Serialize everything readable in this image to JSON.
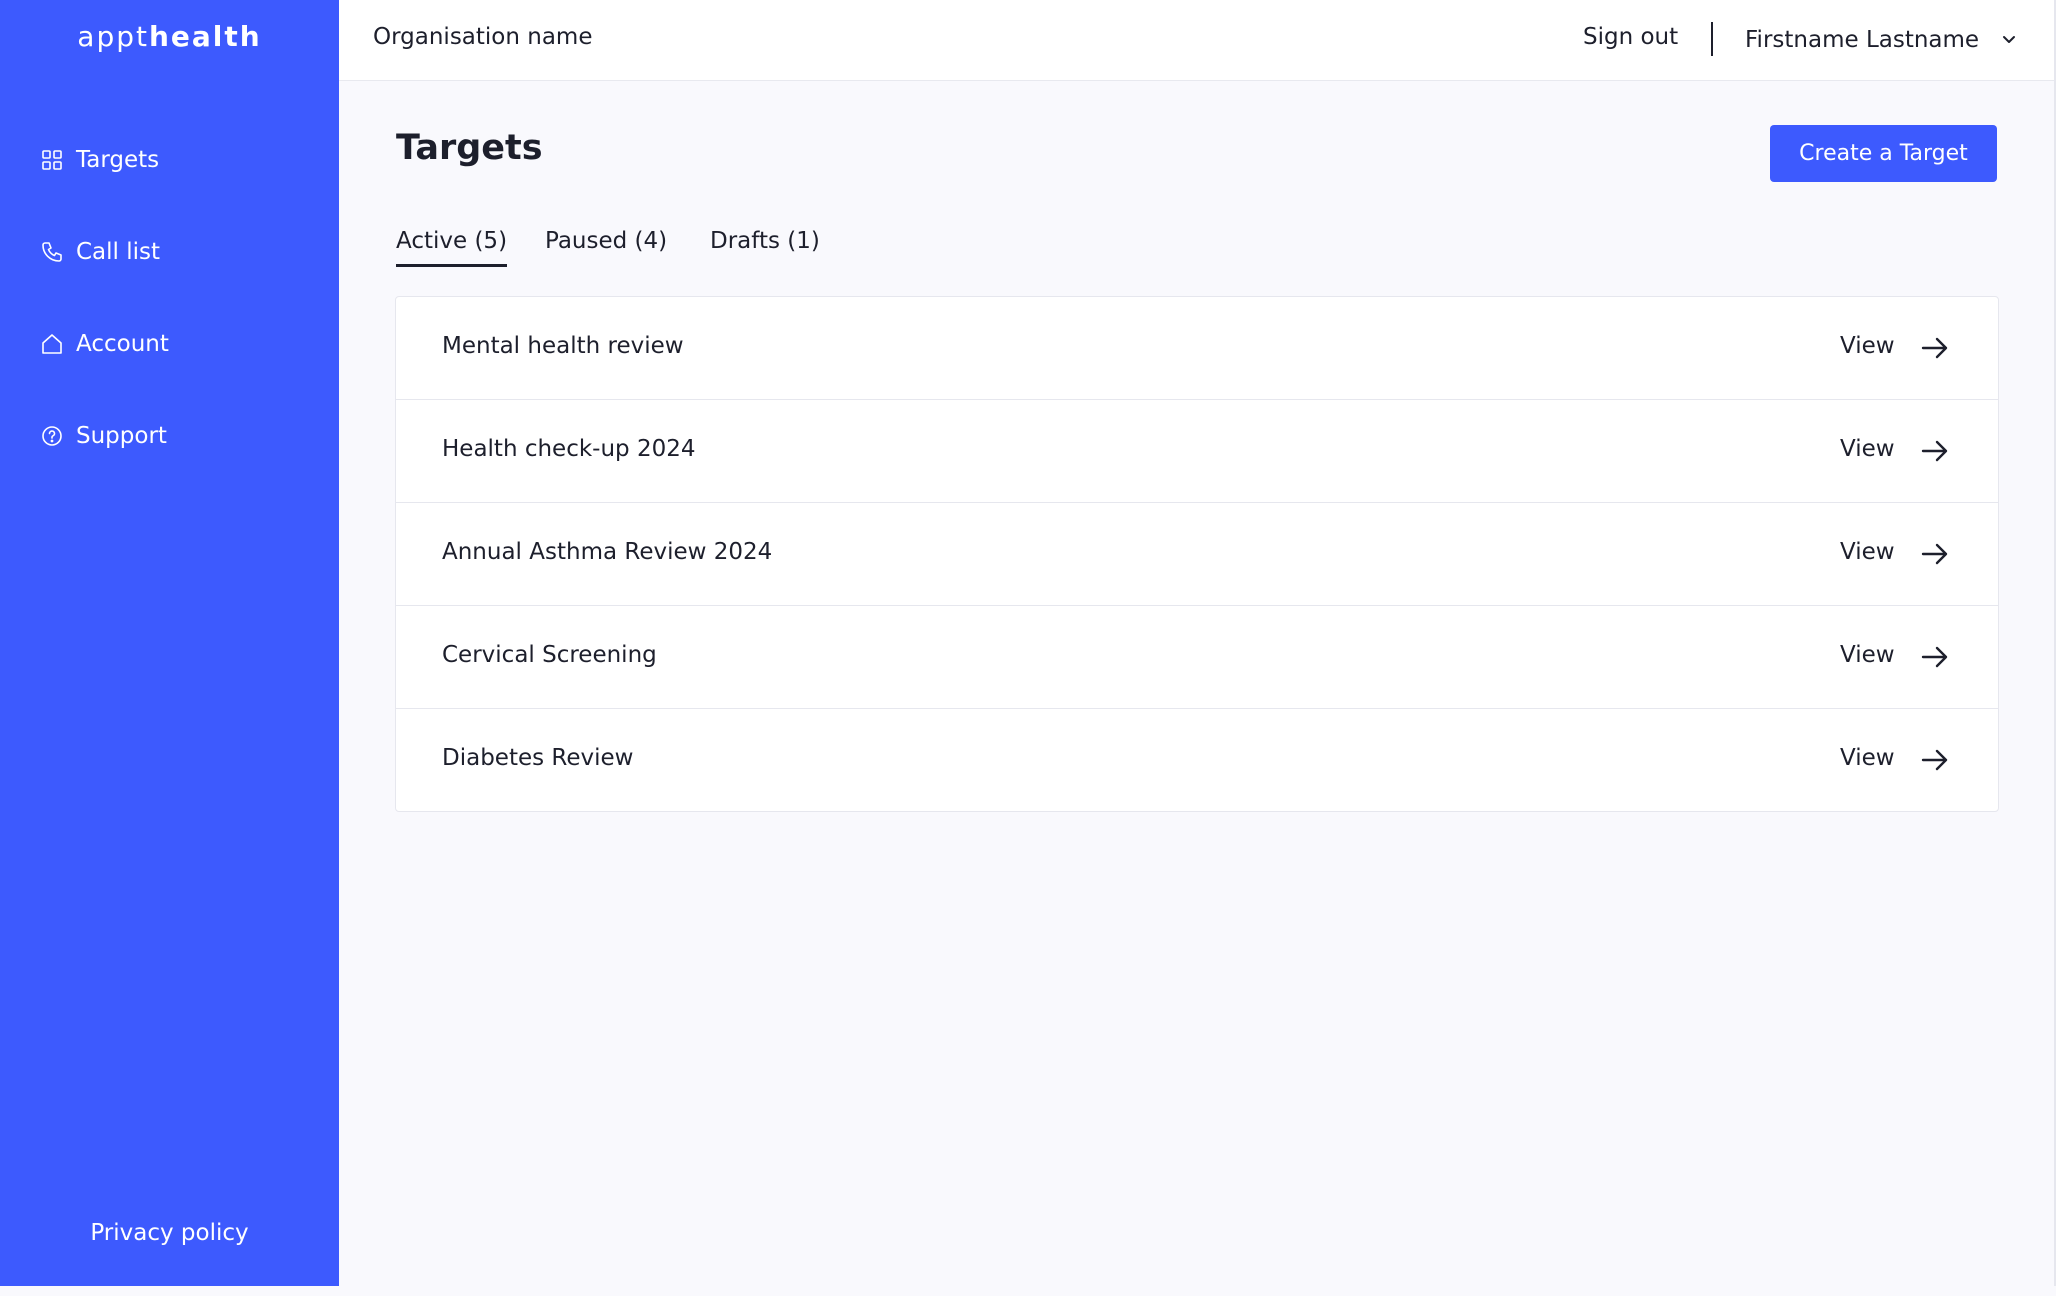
{
  "sidebar": {
    "logo_light": "appt",
    "logo_bold": "health",
    "items": [
      {
        "label": "Targets",
        "icon": "grid-icon"
      },
      {
        "label": "Call list",
        "icon": "phone-icon"
      },
      {
        "label": "Account",
        "icon": "home-icon"
      },
      {
        "label": "Support",
        "icon": "help-circle-icon"
      }
    ],
    "privacy_label": "Privacy policy"
  },
  "header": {
    "org_name": "Organisation name",
    "sign_out": "Sign out",
    "user_name": "Firstname Lastname"
  },
  "main": {
    "title": "Targets",
    "create_button": "Create a Target",
    "tabs": [
      {
        "label": "Active (5)",
        "active": true
      },
      {
        "label": "Paused (4)",
        "active": false
      },
      {
        "label": "Drafts (1)",
        "active": false
      }
    ],
    "targets": [
      {
        "title": "Mental health review",
        "action": "View"
      },
      {
        "title": "Health check-up 2024",
        "action": "View"
      },
      {
        "title": "Annual Asthma Review 2024",
        "action": "View"
      },
      {
        "title": "Cervical Screening",
        "action": "View"
      },
      {
        "title": "Diabetes Review",
        "action": "View"
      }
    ]
  },
  "colors": {
    "brand": "#3d5afe",
    "text": "#1d1f2c",
    "background": "#f9f9fd"
  }
}
